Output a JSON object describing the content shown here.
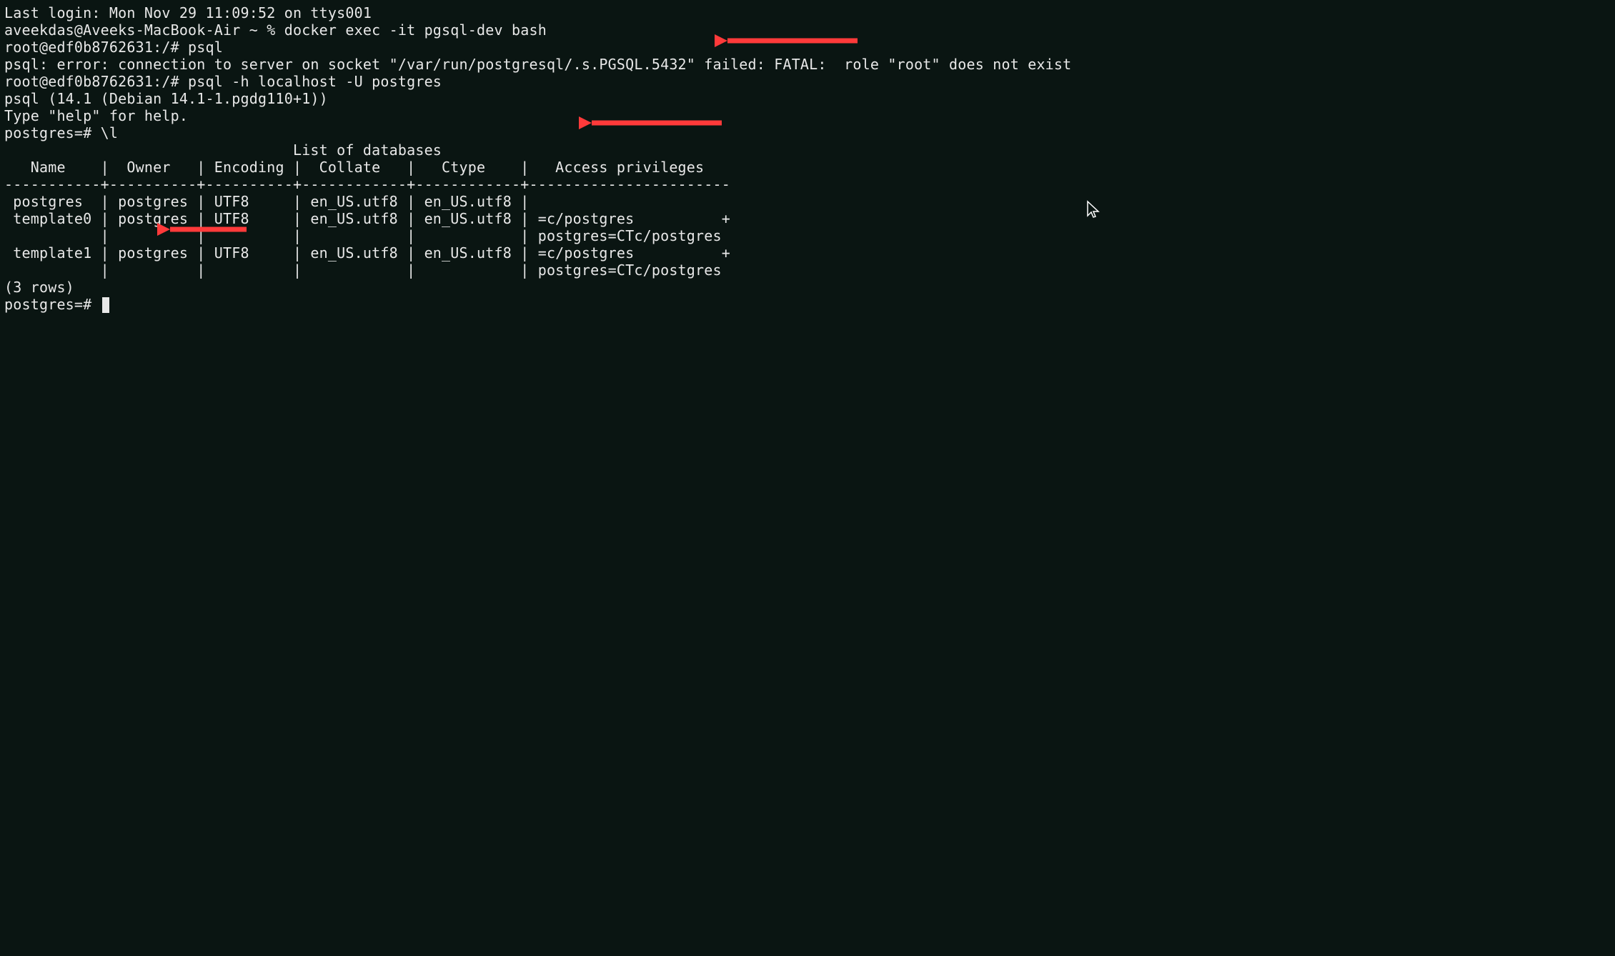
{
  "lines": {
    "login": "Last login: Mon Nov 29 11:09:52 on ttys001",
    "prompt1": "aveekdas@Aveeks-MacBook-Air ~ % docker exec -it pgsql-dev bash",
    "prompt2": "root@edf0b8762631:/# psql",
    "error": "psql: error: connection to server on socket \"/var/run/postgresql/.s.PGSQL.5432\" failed: FATAL:  role \"root\" does not exist",
    "prompt3": "root@edf0b8762631:/# psql -h localhost -U postgres",
    "version": "psql (14.1 (Debian 14.1-1.pgdg110+1))",
    "help": "Type \"help\" for help.",
    "blank1": "",
    "psqlprompt": "postgres=# \\l",
    "listheader": "                                 List of databases",
    "tableheader": "   Name    |  Owner   | Encoding |  Collate   |   Ctype    |   Access privileges   ",
    "divider": "-----------+----------+----------+------------+------------+-----------------------",
    "row1": " postgres  | postgres | UTF8     | en_US.utf8 | en_US.utf8 | ",
    "row2a": " template0 | postgres | UTF8     | en_US.utf8 | en_US.utf8 | =c/postgres          +",
    "row2b": "           |          |          |            |            | postgres=CTc/postgres",
    "row3a": " template1 | postgres | UTF8     | en_US.utf8 | en_US.utf8 | =c/postgres          +",
    "row3b": "           |          |          |            |            | postgres=CTc/postgres",
    "rowcount": "(3 rows)",
    "blank2": "",
    "finalprompt": "postgres=# "
  },
  "arrow_color": "#ff3a3a"
}
